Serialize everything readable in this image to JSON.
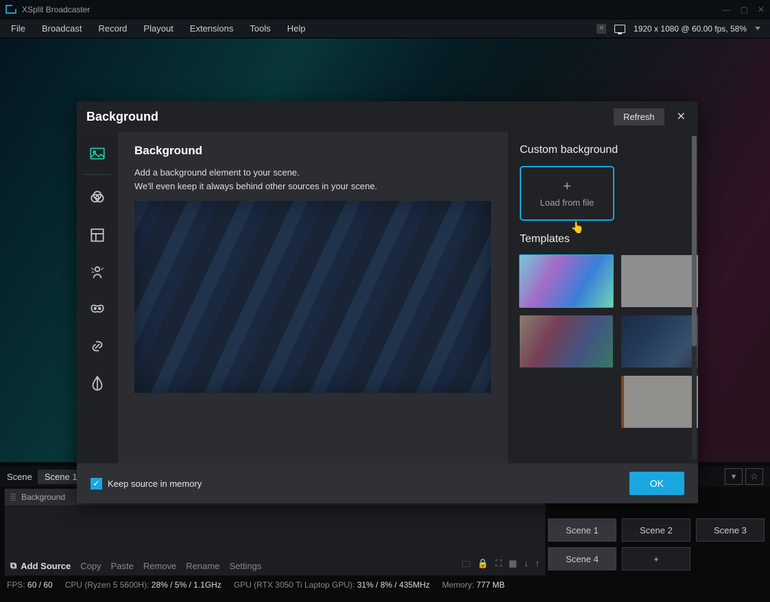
{
  "app": {
    "title": "XSplit Broadcaster"
  },
  "menubar": {
    "items": [
      "File",
      "Broadcast",
      "Record",
      "Playout",
      "Extensions",
      "Tools",
      "Help"
    ],
    "status": "1920 x 1080 @ 60.00 fps, 58%"
  },
  "dialog": {
    "title": "Background",
    "refresh_label": "Refresh",
    "heading": "Background",
    "desc_line1": "Add a background element to your scene.",
    "desc_line2": "We'll even keep it always behind other sources in your scene.",
    "custom_heading": "Custom background",
    "load_label": "Load from file",
    "templates_heading": "Templates",
    "keep_label": "Keep source in memory",
    "ok_label": "OK",
    "sidebar_items": [
      "background",
      "filters",
      "layout",
      "person",
      "mask",
      "link",
      "color"
    ]
  },
  "scene_tab": {
    "label": "Scene",
    "name": "Scene 1",
    "source_name": "Background"
  },
  "source_toolbar": {
    "add": "Add Source",
    "actions": [
      "Copy",
      "Paste",
      "Remove",
      "Rename",
      "Settings"
    ]
  },
  "scenes": [
    "Scene 1",
    "Scene 2",
    "Scene 3",
    "Scene 4"
  ],
  "statusbar": {
    "fps_label": "FPS:",
    "fps": "60 / 60",
    "cpu_label": "CPU (Ryzen 5 5600H):",
    "cpu": "28% / 5% / 1.1GHz",
    "gpu_label": "GPU (RTX 3050 Ti Laptop GPU):",
    "gpu": "31% / 8% / 435MHz",
    "mem_label": "Memory:",
    "mem": "777 MB"
  }
}
